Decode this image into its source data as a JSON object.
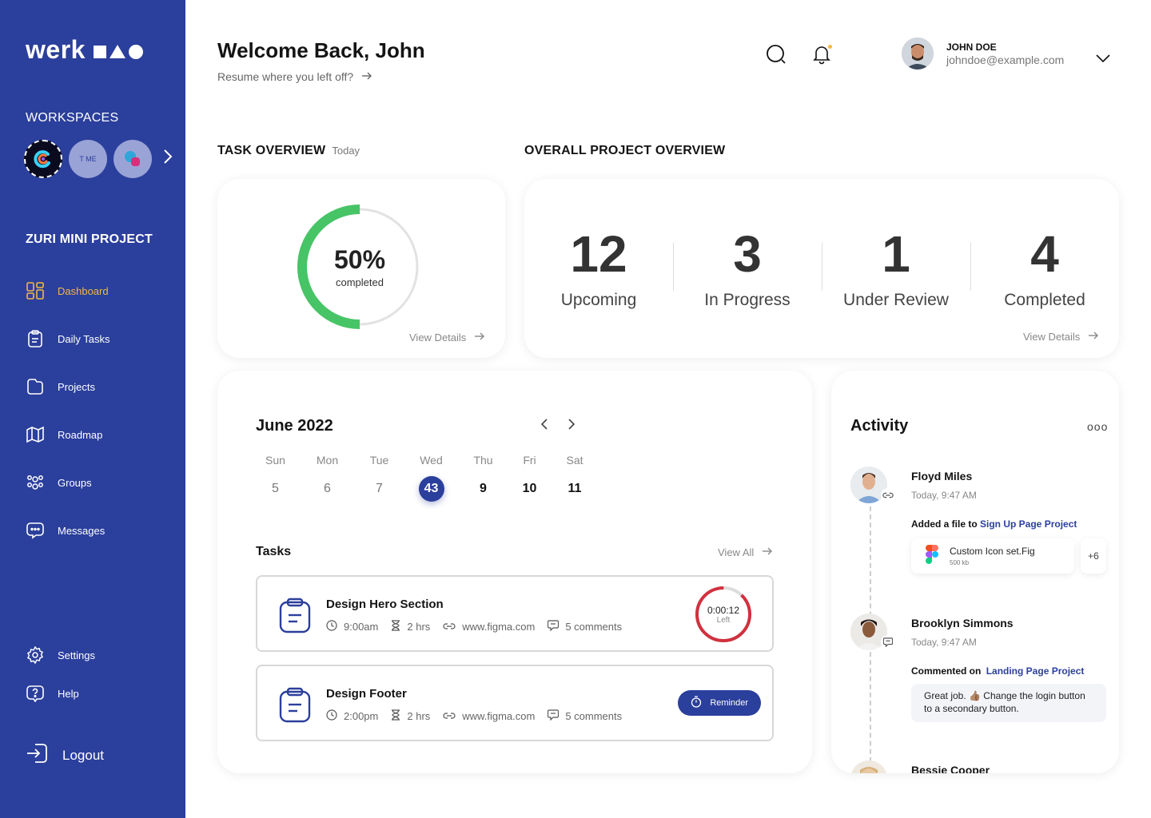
{
  "brand": {
    "name": "werk"
  },
  "sidebar": {
    "workspaces_title": "WORKSPACES",
    "workspaces": [
      {
        "label": ""
      },
      {
        "label": "T ME"
      },
      {
        "label": ""
      }
    ],
    "project_title": "ZURI MINI PROJECT",
    "items": [
      {
        "label": "Dashboard",
        "icon": "dashboard-icon",
        "active": true
      },
      {
        "label": "Daily Tasks",
        "icon": "clipboard-icon"
      },
      {
        "label": "Projects",
        "icon": "folder-icon"
      },
      {
        "label": "Roadmap",
        "icon": "map-icon"
      },
      {
        "label": "Groups",
        "icon": "groups-icon"
      },
      {
        "label": "Messages",
        "icon": "message-icon"
      }
    ],
    "bottom_items": [
      {
        "label": "Settings",
        "icon": "gear-icon"
      },
      {
        "label": "Help",
        "icon": "help-icon"
      }
    ],
    "logout_label": "Logout",
    "accent": "#f4b740",
    "bg": "#2b3f9c"
  },
  "header": {
    "title": "Welcome Back, John",
    "subtitle": "Resume where you left off?",
    "user": {
      "name": "JOHN DOE",
      "email": "johndoe@example.com"
    }
  },
  "task_overview": {
    "title": "TASK OVERVIEW",
    "subtitle": "Today",
    "percent": "50%",
    "percent_value": 0.5,
    "percent_label": "completed",
    "view_details": "View Details"
  },
  "project_overview": {
    "title": "OVERALL PROJECT OVERVIEW",
    "stats": [
      {
        "value": "12",
        "label": "Upcoming"
      },
      {
        "value": "3",
        "label": "In Progress"
      },
      {
        "value": "1",
        "label": "Under Review"
      },
      {
        "value": "4",
        "label": "Completed"
      }
    ],
    "view_details": "View Details"
  },
  "calendar": {
    "month": "June 2022",
    "days": [
      {
        "name": "Sun",
        "date": "5"
      },
      {
        "name": "Mon",
        "date": "6"
      },
      {
        "name": "Tue",
        "date": "7"
      },
      {
        "name": "Wed",
        "date": "43"
      },
      {
        "name": "Thu",
        "date": "9"
      },
      {
        "name": "Fri",
        "date": "10"
      },
      {
        "name": "Sat",
        "date": "11"
      }
    ]
  },
  "tasks": {
    "title": "Tasks",
    "view_all": "View All",
    "items": [
      {
        "name": "Design Hero Section",
        "time": "9:00am",
        "duration": "2 hrs",
        "link": "www.figma.com",
        "comments": "5 comments",
        "timer": "0:00:12",
        "timer_label": "Left",
        "timer_progress": 0.88
      },
      {
        "name": "Design Footer",
        "time": "2:00pm",
        "duration": "2 hrs",
        "link": "www.figma.com",
        "comments": "5 comments",
        "action": "Reminder"
      }
    ]
  },
  "activity": {
    "title": "Activity",
    "more": "ooo",
    "items": [
      {
        "name": "Floyd Miles",
        "time": "Today, 9:47 AM",
        "action": "Added a file to",
        "target": "Sign Up Page Project",
        "file": {
          "name": "Custom Icon set.Fig",
          "size": "500 kb"
        },
        "extra": "+6"
      },
      {
        "name": "Brooklyn Simmons",
        "time": "Today, 9:47 AM",
        "action": "Commented on",
        "target": "Landing Page Project",
        "comment": "Great job. 👍🏽 Change the login button to a secondary button."
      },
      {
        "name": "Bessie Cooper"
      }
    ]
  }
}
